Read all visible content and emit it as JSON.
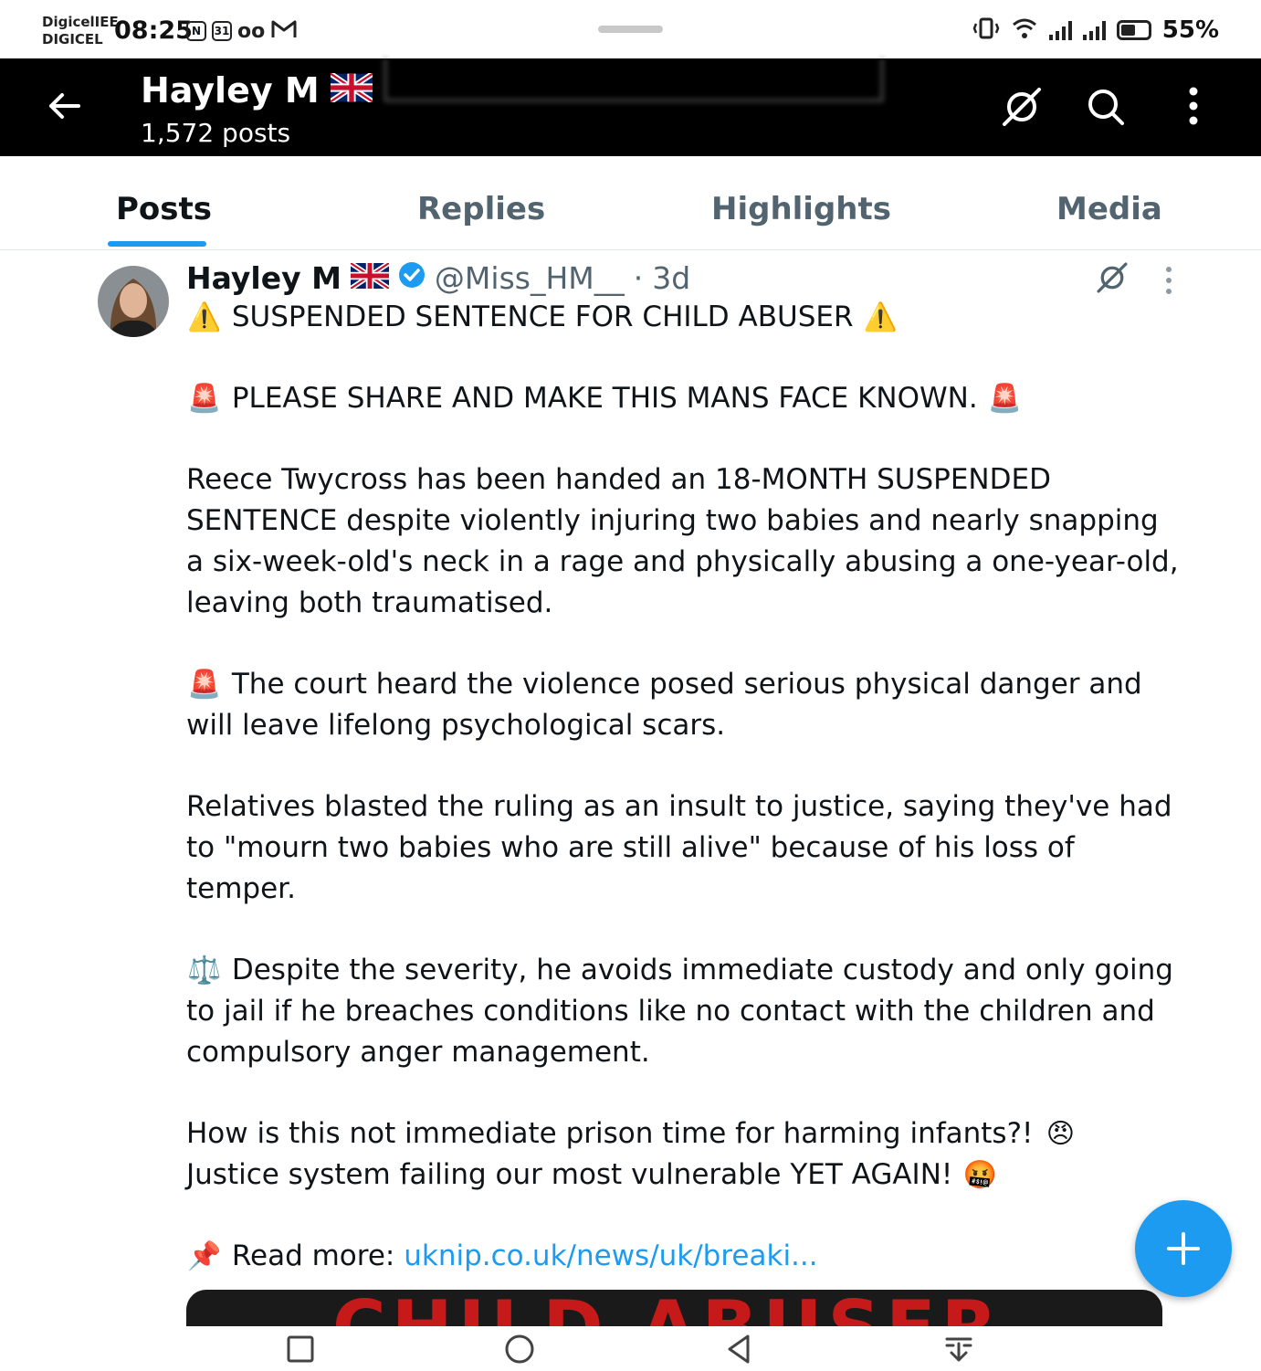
{
  "status_bar": {
    "carrier_line1": "DigicelIEE",
    "carrier_line2": "DIGICEL",
    "time": "08:25",
    "calendar_day": "31",
    "battery_percent": "55%",
    "battery_level": 0.55
  },
  "header": {
    "title": "Hayley M",
    "post_count": "1,572 posts",
    "flag_icon": "uk-flag-icon",
    "background": "#000000"
  },
  "tabs": [
    {
      "label": "Posts",
      "active": true
    },
    {
      "label": "Replies",
      "active": false
    },
    {
      "label": "Highlights",
      "active": false
    },
    {
      "label": "Media",
      "active": false
    }
  ],
  "post": {
    "author": "Hayley M",
    "handle": "@Miss_HM__",
    "separator": "·",
    "time": "3d",
    "verified": true,
    "p1_emoji": "⚠️",
    "p1_text": "SUSPENDED SENTENCE FOR CHILD ABUSER",
    "p2_emoji": "🚨",
    "p2_text": "PLEASE SHARE AND MAKE THIS MANS FACE KNOWN.",
    "p3_text": "Reece Twycross has been handed an 18-MONTH SUSPENDED SENTENCE despite violently injuring two babies and nearly snapping a six-week-old's neck in a rage and physically abusing a one-year-old, leaving both traumatised.",
    "p4_emoji": "🚨",
    "p4_text": "The court heard the violence posed serious physical danger and will leave lifelong psychological scars.",
    "p5_text": "Relatives blasted the ruling as an insult to justice, saying they've had to \"mourn two babies who are still alive\" because of his loss of temper.",
    "p6_emoji": "⚖️",
    "p6_text": "Despite the severity, he avoids immediate custody and only going to jail if he breaches conditions like no contact with the children and compulsory anger management.",
    "p7_text": "How is this not immediate prison time for harming infants?!",
    "p7_emoji": "😠",
    "p8_text": "Justice system failing our most vulnerable YET AGAIN!",
    "p8_emoji": "🤬",
    "p9_emoji": "📌",
    "read_more_label": "Read more:",
    "link": "uknip.co.uk/news/uk/breaki...",
    "card_title": "CHILD ABUSER"
  },
  "colors": {
    "accent": "#1d9bf0",
    "secondary_text": "#536471",
    "primary_text": "#0f1419",
    "card_title": "#c61a1a"
  },
  "nav": {
    "icons": [
      "recents-square-icon",
      "home-circle-icon",
      "back-triangle-icon",
      "notification-pull-icon"
    ]
  }
}
